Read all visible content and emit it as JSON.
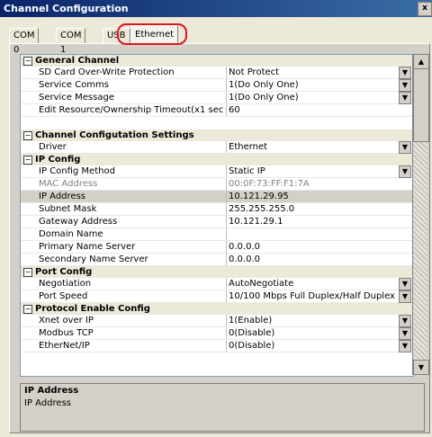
{
  "window": {
    "title": "Channel Configuration",
    "close_label": "x"
  },
  "tabs": [
    {
      "label": "COM 0"
    },
    {
      "label": "COM 1"
    },
    {
      "label": "USB"
    },
    {
      "label": "Ethernet"
    }
  ],
  "grid": {
    "rows": [
      {
        "type": "cat",
        "name": "General Channel"
      },
      {
        "type": "prop",
        "name": "SD Card Over-Write Protection",
        "value": "Not Protect",
        "dd": true
      },
      {
        "type": "prop",
        "name": "Service Comms",
        "value": "1(Do Only One)",
        "dd": true
      },
      {
        "type": "prop",
        "name": "Service Message",
        "value": "1(Do Only One)",
        "dd": true
      },
      {
        "type": "prop",
        "name": "Edit Resource/Ownership Timeout(x1 sec.",
        "value": "60"
      },
      {
        "type": "blank"
      },
      {
        "type": "cat",
        "name": "Channel Configutation Settings"
      },
      {
        "type": "prop",
        "name": "Driver",
        "value": "Ethernet",
        "dd": true
      },
      {
        "type": "cat",
        "name": "IP Config"
      },
      {
        "type": "prop",
        "name": "IP Config Method",
        "value": "Static IP",
        "dd": true
      },
      {
        "type": "prop",
        "name": "MAC Address",
        "value": "00:0F:73:FF:F1:7A",
        "dim": true
      },
      {
        "type": "prop",
        "name": "IP Address",
        "value": "10.121.29.95",
        "sel": true
      },
      {
        "type": "prop",
        "name": "Subnet Mask",
        "value": "255.255.255.0"
      },
      {
        "type": "prop",
        "name": "Gateway Address",
        "value": "10.121.29.1"
      },
      {
        "type": "prop",
        "name": "Domain Name",
        "value": ""
      },
      {
        "type": "prop",
        "name": "Primary Name Server",
        "value": "0.0.0.0"
      },
      {
        "type": "prop",
        "name": "Secondary Name Server",
        "value": "0.0.0.0"
      },
      {
        "type": "cat",
        "name": "Port Config"
      },
      {
        "type": "prop",
        "name": "Negotiation",
        "value": "AutoNegotiate",
        "dd": true
      },
      {
        "type": "prop",
        "name": "Port Speed",
        "value": "10/100 Mbps Full Duplex/Half Duplex",
        "dd": true
      },
      {
        "type": "cat",
        "name": "Protocol Enable Config"
      },
      {
        "type": "prop",
        "name": "Xnet over IP",
        "value": "1(Enable)",
        "dd": true
      },
      {
        "type": "prop",
        "name": "Modbus TCP",
        "value": "0(Disable)",
        "dd": true
      },
      {
        "type": "prop",
        "name": "EtherNet/IP",
        "value": "0(Disable)",
        "dd": true
      }
    ]
  },
  "help": {
    "title": "IP Address",
    "description": "IP Address"
  },
  "icons": {
    "expand_box": "minus-box-icon",
    "dropdown": "dropdown-arrow-icon",
    "scroll_up": "scroll-up-icon",
    "scroll_down": "scroll-down-icon"
  },
  "colors": {
    "highlight": "#e0141e",
    "title_bar": "#0a246a"
  }
}
